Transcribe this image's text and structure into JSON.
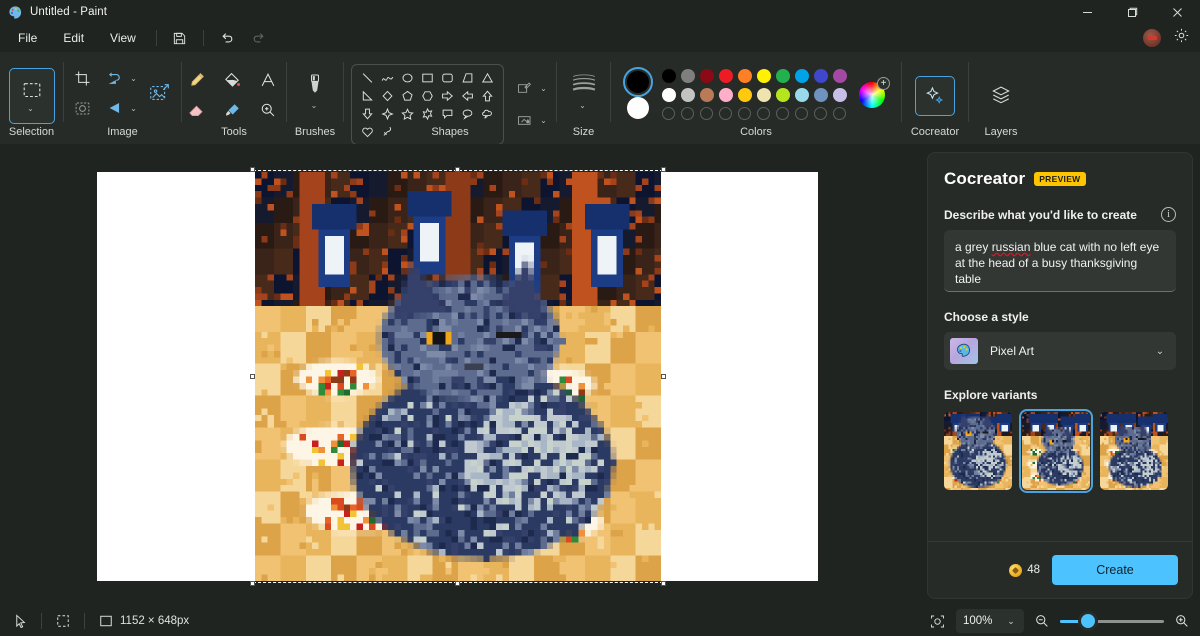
{
  "window": {
    "title": "Untitled - Paint",
    "app_icon": "paint-palette-icon",
    "controls": {
      "minimize": "minimize-icon",
      "maximize": "maximize-icon",
      "close": "close-icon"
    }
  },
  "menubar": {
    "items": [
      {
        "label": "File"
      },
      {
        "label": "Edit"
      },
      {
        "label": "View"
      }
    ],
    "actions": [
      {
        "name": "save-icon",
        "label": "Save"
      },
      {
        "name": "undo-icon",
        "label": "Undo"
      },
      {
        "name": "redo-icon",
        "label": "Redo"
      }
    ],
    "right_icons": [
      {
        "name": "account-icon"
      },
      {
        "name": "settings-gear-icon"
      }
    ]
  },
  "ribbon": {
    "groups": [
      {
        "label": "Selection"
      },
      {
        "label": "Image"
      },
      {
        "label": "Tools"
      },
      {
        "label": "Brushes"
      },
      {
        "label": "Shapes"
      },
      {
        "label": "Size"
      },
      {
        "label": "Colors"
      },
      {
        "label": "Cocreator"
      },
      {
        "label": "Layers"
      }
    ],
    "image_tools": [
      "crop-icon",
      "rotate-icon",
      "resize-image-icon",
      "transparent-select-icon",
      "flip-icon"
    ],
    "tools": [
      "pencil-icon",
      "fill-bucket-icon",
      "text-icon",
      "eraser-icon",
      "eyedropper-icon",
      "magnifier-icon"
    ],
    "shapes": [
      "line",
      "curve",
      "oval",
      "rectangle",
      "rounded-rectangle",
      "right-triangle",
      "triangle",
      "diagonal-triangle",
      "diamond",
      "pentagon",
      "hexagon",
      "right-arrow",
      "left-arrow",
      "up-arrow",
      "down-arrow",
      "four-point-star",
      "five-point-star",
      "six-point-star",
      "rounded-callout",
      "oval-callout",
      "cloud-callout",
      "heart",
      "lightning"
    ],
    "shape_side": [
      "outline-icon",
      "fill-icon"
    ],
    "colors": {
      "primary": "#000000",
      "secondary": "#ffffff",
      "row1": [
        "#000000",
        "#7f7f7f",
        "#8b0a16",
        "#ed1c24",
        "#ff7f27",
        "#fff200",
        "#22b14c",
        "#00a2e8",
        "#3f48cc",
        "#a349a4"
      ],
      "row2": [
        "#ffffff",
        "#c3c3c3",
        "#b97a57",
        "#ffaec9",
        "#ffc90e",
        "#efe4b0",
        "#b5e61d",
        "#99d9ea",
        "#7092be",
        "#c8bfe7"
      ],
      "row3_empty_count": 10,
      "edit_colors": "color-wheel-icon"
    }
  },
  "canvas": {
    "selection_active": true,
    "image_description": "pixel-art-grey-cat-at-thanksgiving-table"
  },
  "cocreator": {
    "title": "Cocreator",
    "badge": "PREVIEW",
    "describe_label": "Describe what you'd like to create",
    "info_icon": "info-icon",
    "prompt_value": "a grey russian blue cat with no left eye at the head of a busy thanksgiving table",
    "prompt_word_misspelled": "russian",
    "prompt_part1": "a grey ",
    "prompt_part2": " blue cat with no left eye at the head of a busy thanksgiving table",
    "style_label": "Choose a style",
    "style_selected": "Pixel Art",
    "style_chevron": "chevron-down-icon",
    "variants_label": "Explore variants",
    "variants": [
      {
        "name": "variant-1",
        "selected": false
      },
      {
        "name": "variant-2",
        "selected": true
      },
      {
        "name": "variant-3",
        "selected": false
      }
    ],
    "credits": "48",
    "credits_icon": "coin-icon",
    "create_label": "Create"
  },
  "statusbar": {
    "cursor_icon": "cursor-arrow-icon",
    "selection_icon": "selection-icon",
    "size_icon": "image-size-icon",
    "size_text": "1152 × 648px",
    "fit_icon": "fit-to-window-icon",
    "zoom_level": "100%",
    "zoom_out_icon": "zoom-out-icon",
    "zoom_in_icon": "zoom-in-icon",
    "zoom_slider_percent": 15
  }
}
